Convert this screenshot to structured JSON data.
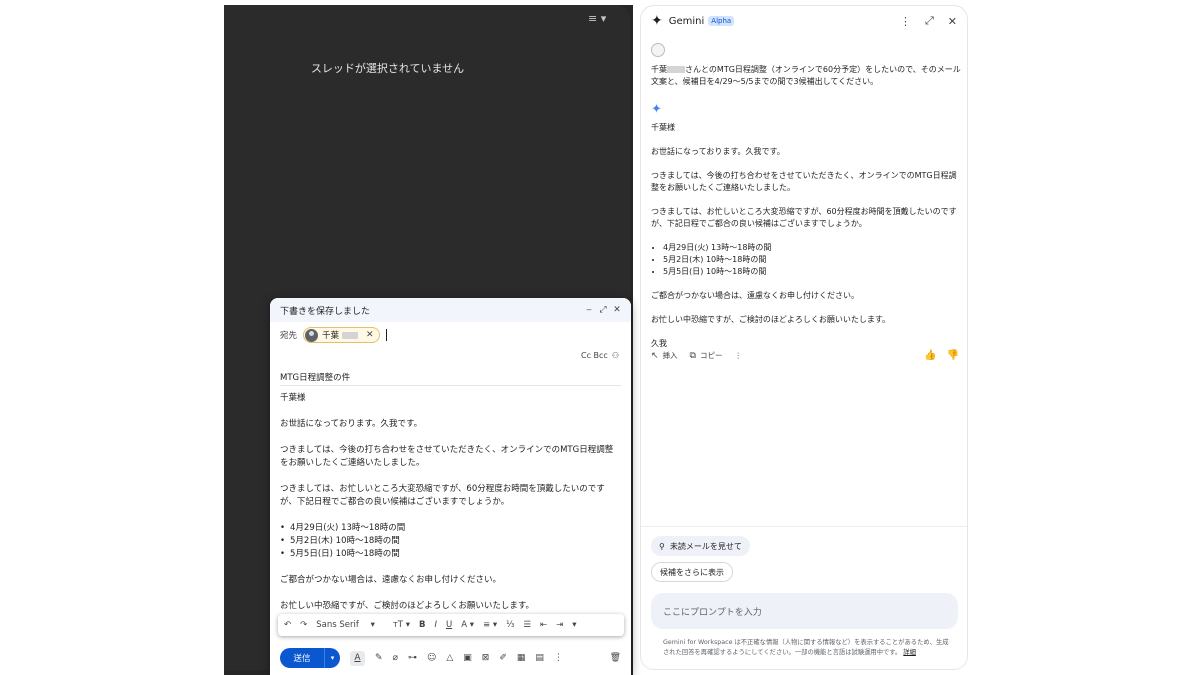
{
  "gmail": {
    "view_toggle_icon": "≡ ▾",
    "empty_thread_text": "スレッドが選択されていません"
  },
  "compose": {
    "header_title": "下書きを保存しました",
    "minimize_icon": "‒",
    "expand_icon": "⤢",
    "close_icon": "✕",
    "to_label": "宛先",
    "recipient_name": "千葉",
    "recipient_remove_icon": "✕",
    "cc_bcc_label": "Cc Bcc",
    "subject": "MTG日程調整の件",
    "body": {
      "greeting": "千葉様",
      "line1": "お世話になっております。久我です。",
      "para2": "つきましては、今後の打ち合わせをさせていただきたく、オンラインでのMTG日程調整をお願いしたくご連絡いたしました。",
      "para3": "つきましては、お忙しいところ大変恐縮ですが、60分程度お時間を頂戴したいのですが、下記日程でご都合の良い候補はございますでしょうか。",
      "dates": [
        "4月29日(火) 13時〜18時の間",
        "5月2日(木) 10時〜18時の間",
        "5月5日(日) 10時〜18時の間"
      ],
      "para4": "ご都合がつかない場合は、遠慮なくお申し付けください。",
      "para5": "お忙しい中恐縮ですが、ご検討のほどよろしくお願いいたします。"
    },
    "format_bar": {
      "undo": "↶",
      "redo": "↷",
      "font": "Sans Serif",
      "font_dd": "▾",
      "size": "тT ▾",
      "bold": "B",
      "italic": "I",
      "underline": "U",
      "color": "A ▾",
      "align": "≡ ▾",
      "numbered": "⅓",
      "bulleted": "☰",
      "indent_less": "⇤",
      "indent_more": "⇥",
      "more": "▾"
    },
    "send_label": "送信",
    "send_dd": "▾",
    "bottom_tools": {
      "text_format": "A",
      "ai_write": "✎",
      "attach": "⌀",
      "link": "⊶",
      "emoji": "☺",
      "drive": "△",
      "photo": "▣",
      "lock": "⊠",
      "signature": "✐",
      "layout": "▦",
      "schedule": "▤",
      "more": "⋮",
      "trash": "🗑"
    }
  },
  "gemini": {
    "star_icon": "✦",
    "title": "Gemini",
    "badge": "Alpha",
    "more_icon": "⋮",
    "expand_icon": "⤢",
    "close_icon": "✕",
    "prompt_part1": "千葉",
    "prompt_part2": "さんとのMTG日程調整（オンラインで60分予定）をしたいので、そのメール文案と、候補日を4/29〜5/5までの間で3候補出してください。",
    "response_icon": "✦",
    "response": {
      "greeting": "千葉様",
      "line1": "お世話になっております。久我です。",
      "para2": "つきましては、今後の打ち合わせをさせていただきたく、オンラインでのMTG日程調整をお願いしたくご連絡いたしました。",
      "para3": "つきましては、お忙しいところ大変恐縮ですが、60分程度お時間を頂戴したいのですが、下記日程でご都合の良い候補はございますでしょうか。",
      "dates": [
        "4月29日(火) 13時〜18時の間",
        "5月2日(木) 10時〜18時の間",
        "5月5日(日) 10時〜18時の間"
      ],
      "para4": "ご都合がつかない場合は、遠慮なくお申し付けください。",
      "para5": "お忙しい中恐縮ですが、ご検討のほどよろしくお願いいたします。",
      "signoff": "久我"
    },
    "actions": {
      "insert_icon": "↖",
      "insert": "挿入",
      "copy_icon": "⧉",
      "copy": "コピー",
      "more_icon": "⋮",
      "thumbs_up": "👍",
      "thumbs_down": "👎"
    },
    "suggestions": [
      {
        "icon": "⚲",
        "label": "未読メールを見せて"
      },
      {
        "icon": "",
        "label": "候補をさらに表示"
      }
    ],
    "input_placeholder": "ここにプロンプトを入力",
    "disclaimer": "Gemini for Workspace は不正確な情報（人物に関する情報など）を表示することがあるため、生成された回答を再確認するようにしてください。一部の機能と言語は試験運用中です。",
    "disclaimer_link": "詳細"
  }
}
